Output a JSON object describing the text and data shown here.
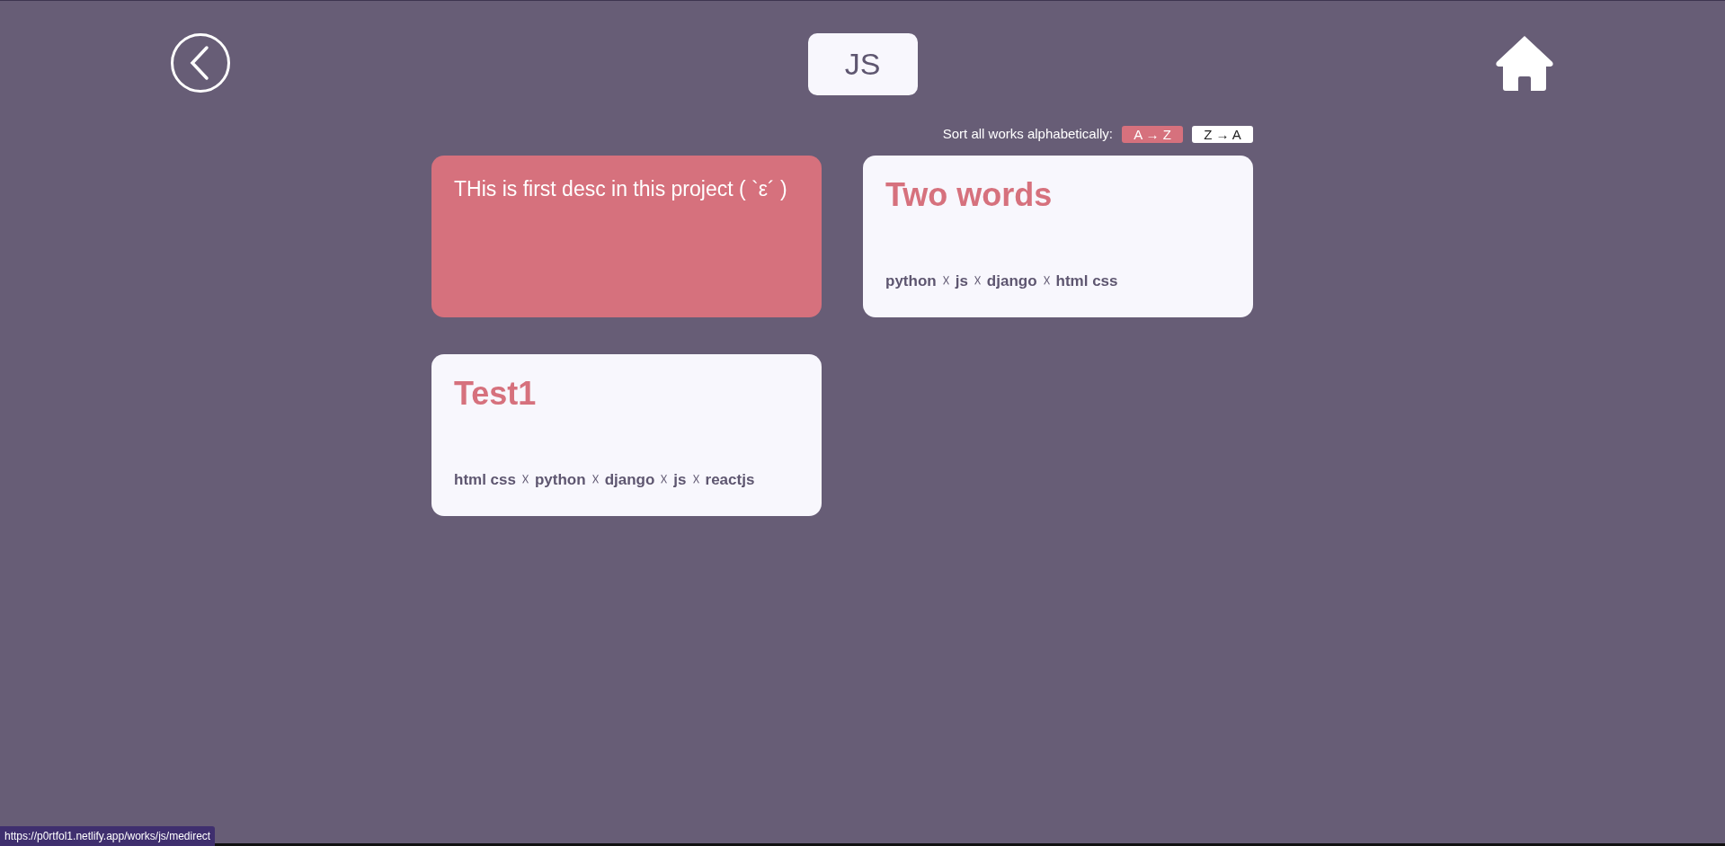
{
  "header": {
    "title": "JS"
  },
  "sort": {
    "label": "Sort all works alphabetically:",
    "options": [
      {
        "label": "A → Z",
        "selected": true
      },
      {
        "label": "Z → A",
        "selected": false
      }
    ]
  },
  "works": [
    {
      "kind": "description",
      "text": "THis is first desc in this project ( `ε´ )"
    },
    {
      "kind": "title",
      "title": "Two words",
      "tags": [
        {
          "kind": "tag",
          "text": "python"
        },
        {
          "kind": "separator",
          "text": "☓"
        },
        {
          "kind": "tag",
          "text": "js"
        },
        {
          "kind": "separator",
          "text": "☓"
        },
        {
          "kind": "tag",
          "text": "django"
        },
        {
          "kind": "separator",
          "text": "☓"
        },
        {
          "kind": "tag",
          "text": "html css"
        }
      ]
    },
    {
      "kind": "title",
      "title": "Test1",
      "tags": [
        {
          "kind": "tag",
          "text": "html css"
        },
        {
          "kind": "separator",
          "text": "☓"
        },
        {
          "kind": "tag",
          "text": "python"
        },
        {
          "kind": "separator",
          "text": "☓"
        },
        {
          "kind": "tag",
          "text": "django"
        },
        {
          "kind": "separator",
          "text": "☓"
        },
        {
          "kind": "tag",
          "text": "js"
        },
        {
          "kind": "separator",
          "text": "☓"
        },
        {
          "kind": "tag",
          "text": "reactjs"
        }
      ]
    }
  ],
  "status_bar": {
    "url": "https://p0rtfol1.netlify.app/works/js/medirect"
  }
}
